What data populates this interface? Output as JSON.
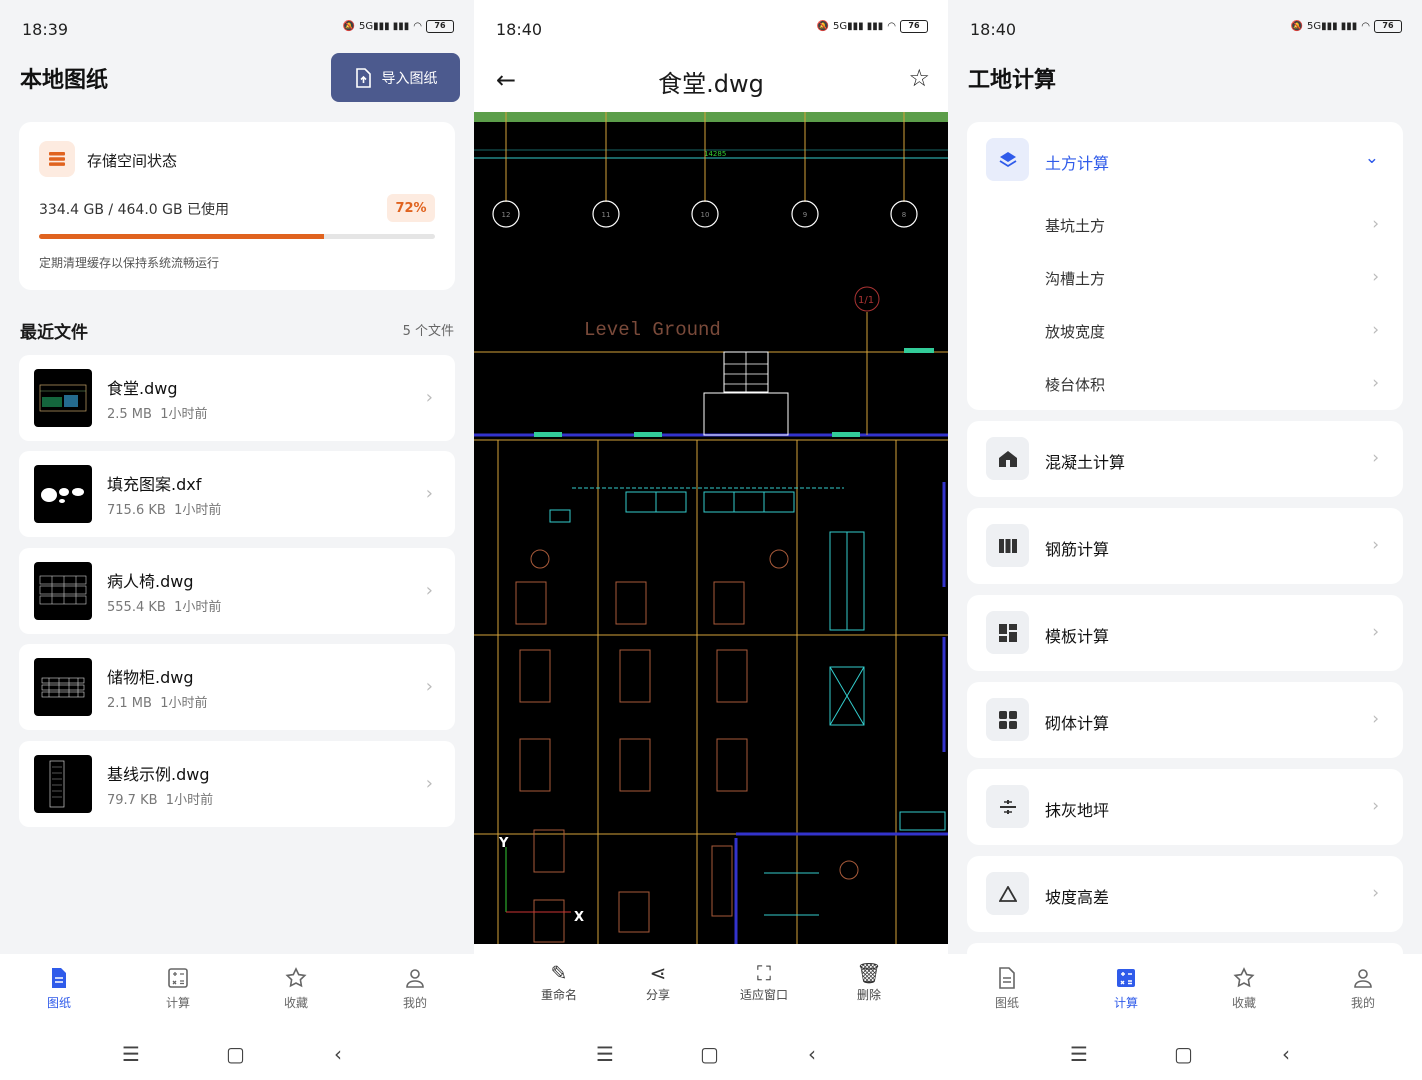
{
  "screen1": {
    "status": {
      "time": "18:39",
      "battery": "76"
    },
    "title": "本地图纸",
    "import_label": "导入图纸",
    "storage": {
      "title": "存储空间状态",
      "usage": "334.4 GB / 464.0 GB 已使用",
      "percent": "72%",
      "fill_fraction": 0.72,
      "note": "定期清理缓存以保持系统流畅运行"
    },
    "recent_title": "最近文件",
    "recent_count": "5 个文件",
    "files": [
      {
        "name": "食堂.dwg",
        "size": "2.5 MB",
        "time": "1小时前"
      },
      {
        "name": "填充图案.dxf",
        "size": "715.6 KB",
        "time": "1小时前"
      },
      {
        "name": "病人椅.dwg",
        "size": "555.4 KB",
        "time": "1小时前"
      },
      {
        "name": "储物柜.dwg",
        "size": "2.1 MB",
        "time": "1小时前"
      },
      {
        "name": "基线示例.dwg",
        "size": "79.7 KB",
        "time": "1小时前"
      }
    ],
    "nav": [
      "图纸",
      "计算",
      "收藏",
      "我的"
    ]
  },
  "screen2": {
    "status": {
      "time": "18:40",
      "battery": "76"
    },
    "title": "食堂.dwg",
    "cad_text": {
      "level": "Level Ground",
      "axis_y": "Y",
      "axis_x": "X",
      "dim": "14285",
      "grid": [
        "12",
        "11",
        "10",
        "9",
        "8"
      ],
      "marker": "1/1"
    },
    "tools": [
      "重命名",
      "分享",
      "适应窗口",
      "删除"
    ]
  },
  "screen3": {
    "status": {
      "time": "18:40",
      "battery": "76"
    },
    "title": "工地计算",
    "earth": {
      "label": "土方计算",
      "items": [
        "基坑土方",
        "沟槽土方",
        "放坡宽度",
        "棱台体积"
      ]
    },
    "groups": [
      "混凝土计算",
      "钢筋计算",
      "模板计算",
      "砌体计算",
      "抹灰地坪",
      "坡度高差"
    ],
    "nav": [
      "图纸",
      "计算",
      "收藏",
      "我的"
    ]
  },
  "colors": {
    "accent": "#2f5bea",
    "import_button": "#4c5a8e",
    "storage_orange": "#e0631f"
  }
}
